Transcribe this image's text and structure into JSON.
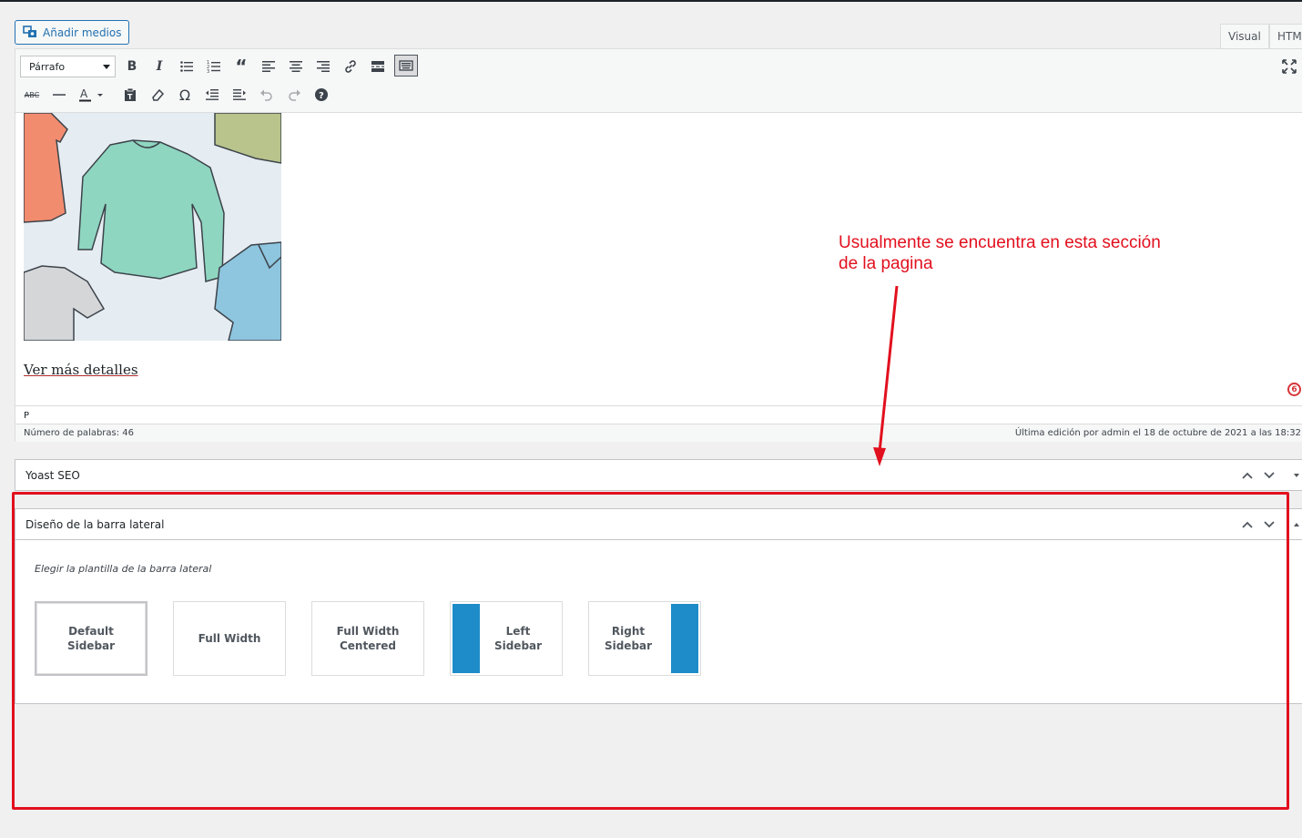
{
  "toolbar": {
    "add_media_label": "Añadir medios",
    "format_select_value": "Párrafo",
    "tabs": {
      "visual": "Visual",
      "html": "HTML"
    }
  },
  "editor": {
    "link_text": "Ver más detalles",
    "badge": "6",
    "path": "P",
    "word_count": "Número de palabras: 46",
    "last_edit": "Última edición por admin el 18 de octubre de 2021 a las 18:32"
  },
  "yoast": {
    "title": "Yoast SEO"
  },
  "sidebar_layout": {
    "title": "Diseño de la barra lateral",
    "description": "Elegir la plantilla de la barra lateral",
    "options": [
      {
        "line1": "Default",
        "line2": "Sidebar"
      },
      {
        "line1": "Full Width",
        "line2": ""
      },
      {
        "line1": "Full Width",
        "line2": "Centered"
      },
      {
        "line1": "Left",
        "line2": "Sidebar"
      },
      {
        "line1": "Right",
        "line2": "Sidebar"
      }
    ],
    "accent_color": "#1e8cc9"
  },
  "annotation": {
    "line1": "Usualmente se encuentra en esta sección",
    "line2": "de la pagina",
    "color": "#e2101e"
  }
}
